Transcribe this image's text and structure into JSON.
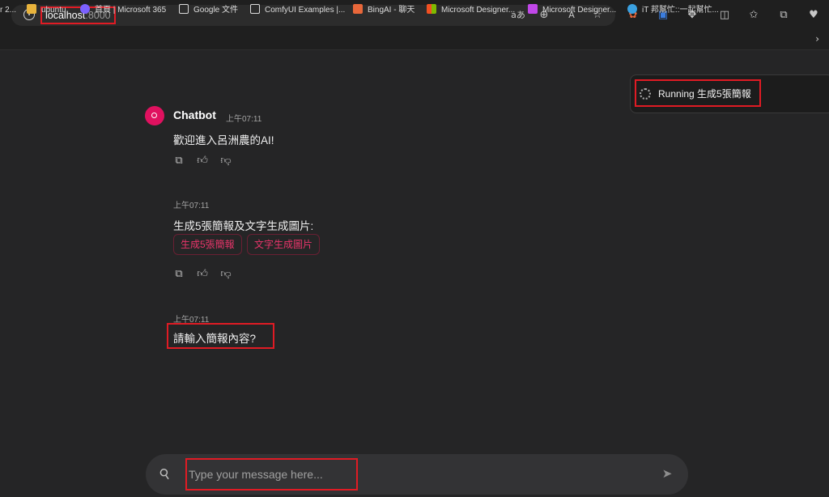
{
  "browser": {
    "url_host": "localhost",
    "url_port": ":8000",
    "toolbar_icons": [
      "info-icon",
      "read-aloud-icon",
      "zoom-icon",
      "immersive-reader-icon",
      "favorite-star-icon",
      "extension-icon",
      "translate-icon",
      "extensions-puzzle-icon",
      "split-screen-icon",
      "favorites-icon",
      "collections-icon",
      "health-icon"
    ]
  },
  "bookmarks": [
    {
      "label": "r 2...",
      "icon": "truncated"
    },
    {
      "label": "ubuntu",
      "icon": "folder-icon",
      "color": "#e8b33c"
    },
    {
      "label": "首頁 | Microsoft 365",
      "icon": "m365-icon",
      "color": "#7b61ff"
    },
    {
      "label": "Google 文件",
      "icon": "page-icon",
      "color": "#dcdcdc"
    },
    {
      "label": "ComfyUI Examples |...",
      "icon": "page-icon",
      "color": "#dcdcdc"
    },
    {
      "label": "BingAI - 聊天",
      "icon": "bing-icon",
      "color": "#e8673a"
    },
    {
      "label": "Microsoft Designer...",
      "icon": "microsoft-icon",
      "color": "#f25022"
    },
    {
      "label": "Microsoft Designer...",
      "icon": "designer-icon",
      "color": "#c147e9"
    },
    {
      "label": "iT 邦幫忙::一起幫忙...",
      "icon": "ithome-icon",
      "color": "#3aa0e0"
    }
  ],
  "toast": {
    "text": "Running 生成5張簡報"
  },
  "chat": {
    "bot_name": "Chatbot",
    "messages": [
      {
        "time": "上午07:11",
        "text": "歡迎進入呂洲農的AI!"
      },
      {
        "time": "上午07:11",
        "text": "生成5張簡報及文字生成圖片:",
        "actions": [
          "生成5張簡報",
          "文字生成圖片"
        ]
      },
      {
        "time": "上午07:11",
        "text": "請輸入簡報內容?"
      }
    ]
  },
  "composer": {
    "placeholder": "Type your message here..."
  },
  "colors": {
    "accent": "#e0115f",
    "highlight": "#e01b24"
  }
}
